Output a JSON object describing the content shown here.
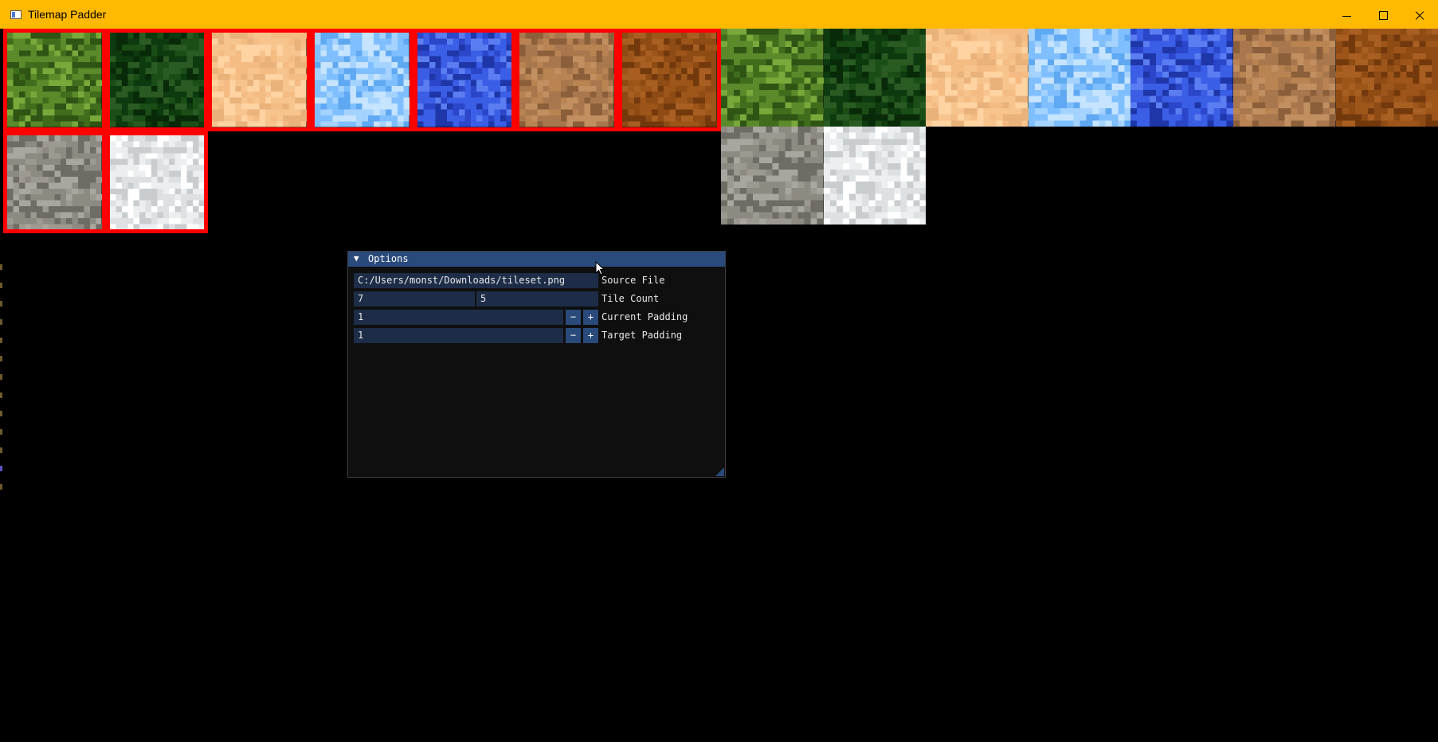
{
  "window": {
    "title": "Tilemap Padder",
    "controls": [
      "minimize",
      "maximize",
      "close"
    ],
    "accent_color": "#ffb900"
  },
  "tileset": {
    "padding_color": "#ff0000",
    "tiles": [
      {
        "name": "grass",
        "base": "#5a8a2a",
        "accents": [
          "#3f6d1c",
          "#79a93a",
          "#2f5414"
        ]
      },
      {
        "name": "dark-grass",
        "base": "#0d3a0e",
        "accents": [
          "#1b4e16",
          "#082a09",
          "#2a5b22"
        ]
      },
      {
        "name": "sand",
        "base": "#f7c48e",
        "accents": [
          "#ffd3a2",
          "#e9b27b",
          "#f4bb83"
        ]
      },
      {
        "name": "shallow-water",
        "base": "#7fbfff",
        "accents": [
          "#a5d3ff",
          "#5fa8f2",
          "#c6e4ff"
        ]
      },
      {
        "name": "deep-water",
        "base": "#3b5ee6",
        "accents": [
          "#2b46c9",
          "#5b7df2",
          "#1e36a8"
        ]
      },
      {
        "name": "dirt",
        "base": "#a9774d",
        "accents": [
          "#c28f61",
          "#8c5f3b",
          "#b98352"
        ]
      },
      {
        "name": "mud",
        "base": "#8e4b14",
        "accents": [
          "#a95f21",
          "#73390d",
          "#9d5519"
        ]
      },
      {
        "name": "stone",
        "base": "#8d8a82",
        "accents": [
          "#a9a69f",
          "#6f6c66",
          "#9c9991"
        ]
      },
      {
        "name": "snow",
        "base": "#eceff0",
        "accents": [
          "#ffffff",
          "#c9cdd0",
          "#dde1e3"
        ]
      }
    ]
  },
  "options": {
    "title": "Options",
    "source_file_value": "C:/Users/monst/Downloads/tileset.png",
    "source_file_label": "Source File",
    "tile_count_x": "7",
    "tile_count_y": "5",
    "tile_count_label": "Tile Count",
    "current_padding_value": "1",
    "current_padding_label": "Current Padding",
    "target_padding_value": "1",
    "target_padding_label": "Target Padding",
    "minus": "−",
    "plus": "+"
  }
}
